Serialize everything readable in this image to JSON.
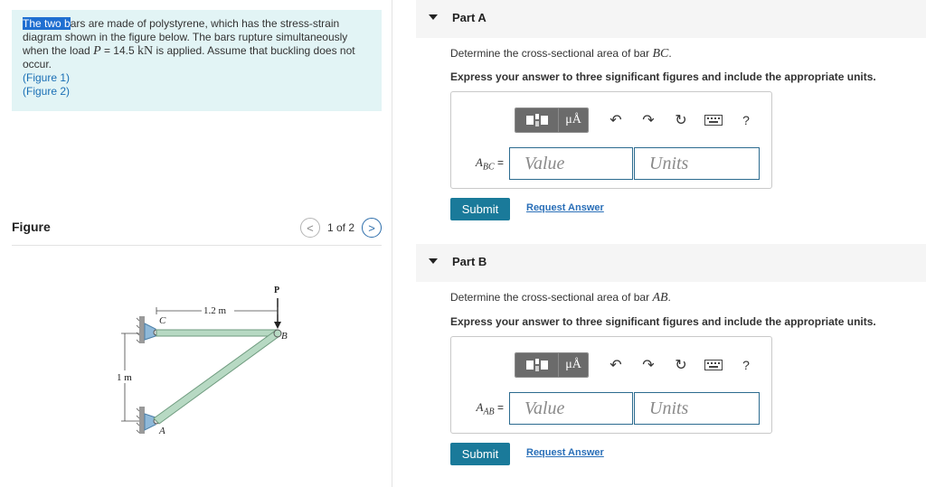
{
  "problem": {
    "highlight": "The two b",
    "text1": "ars are made of polystyrene, which has the stress-strain diagram shown in the figure below. The bars rupture simultaneously when the load ",
    "load_symbol": "P",
    "load_eq": " = 14.5 ",
    "load_unit": "kN",
    "text2": " is applied. Assume that buckling does not occur.",
    "links": [
      "(Figure 1)",
      "(Figure 2)"
    ]
  },
  "figure_panel": {
    "title": "Figure",
    "prev_label": "<",
    "next_label": ">",
    "page_indicator": "1 of 2",
    "labels": {
      "P": "P",
      "C": "C",
      "B": "B",
      "A": "A",
      "len_top": "1.2 m",
      "len_side": "1 m"
    }
  },
  "parts": [
    {
      "title": "Part A",
      "prompt_prefix": "Determine the cross-sectional area of bar ",
      "bar": "BC",
      "prompt_suffix": ".",
      "instruction": "Express your answer to three significant figures and include the appropriate units.",
      "answer_symbol": "A",
      "answer_sub": "BC",
      "answer_eq": " =",
      "value_placeholder": "Value",
      "units_placeholder": "Units",
      "submit_label": "Submit",
      "request_label": "Request Answer"
    },
    {
      "title": "Part B",
      "prompt_prefix": "Determine the cross-sectional area of bar ",
      "bar": "AB",
      "prompt_suffix": ".",
      "instruction": "Express your answer to three significant figures and include the appropriate units.",
      "answer_symbol": "A",
      "answer_sub": "AB",
      "answer_eq": " =",
      "value_placeholder": "Value",
      "units_placeholder": "Units",
      "submit_label": "Submit",
      "request_label": "Request Answer"
    }
  ],
  "toolbar": {
    "units_button": "μÅ",
    "help": "?",
    "icons": [
      "templates-icon",
      "units-icon",
      "undo-icon",
      "redo-icon",
      "reset-icon",
      "keyboard-icon",
      "help-icon"
    ]
  }
}
